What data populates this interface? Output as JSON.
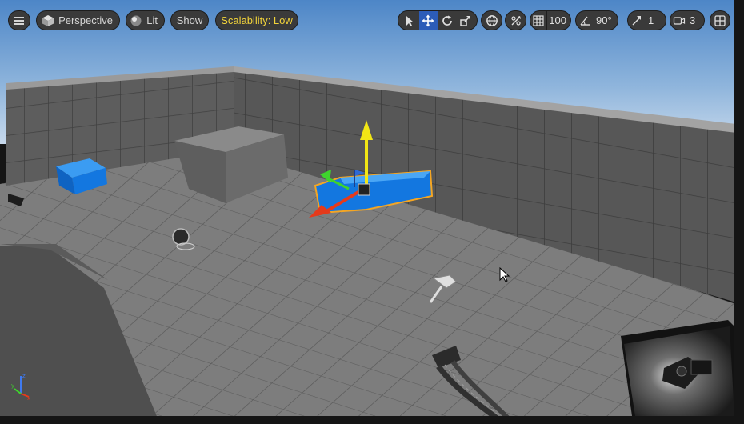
{
  "toolbar": {
    "view_mode": "Perspective",
    "lighting": "Lit",
    "show": "Show",
    "scalability": "Scalability: Low",
    "grid_size": "100",
    "rotation_snap": "90°",
    "camera_speed": "1",
    "screen_percentage": "3"
  },
  "tools": {
    "select": "select-arrow-icon",
    "translate": "translate-icon",
    "rotate": "rotate-icon",
    "scale": "scale-icon",
    "active": "translate"
  },
  "colors": {
    "selected_actor": "#1277e6",
    "selection_outline": "#f5a623",
    "gizmo_up": "#f2e615",
    "gizmo_x": "#e53a1b",
    "gizmo_y": "#3fd32d",
    "toolbar_active": "#2c5cb8",
    "scalability_text": "#f1d33a"
  }
}
